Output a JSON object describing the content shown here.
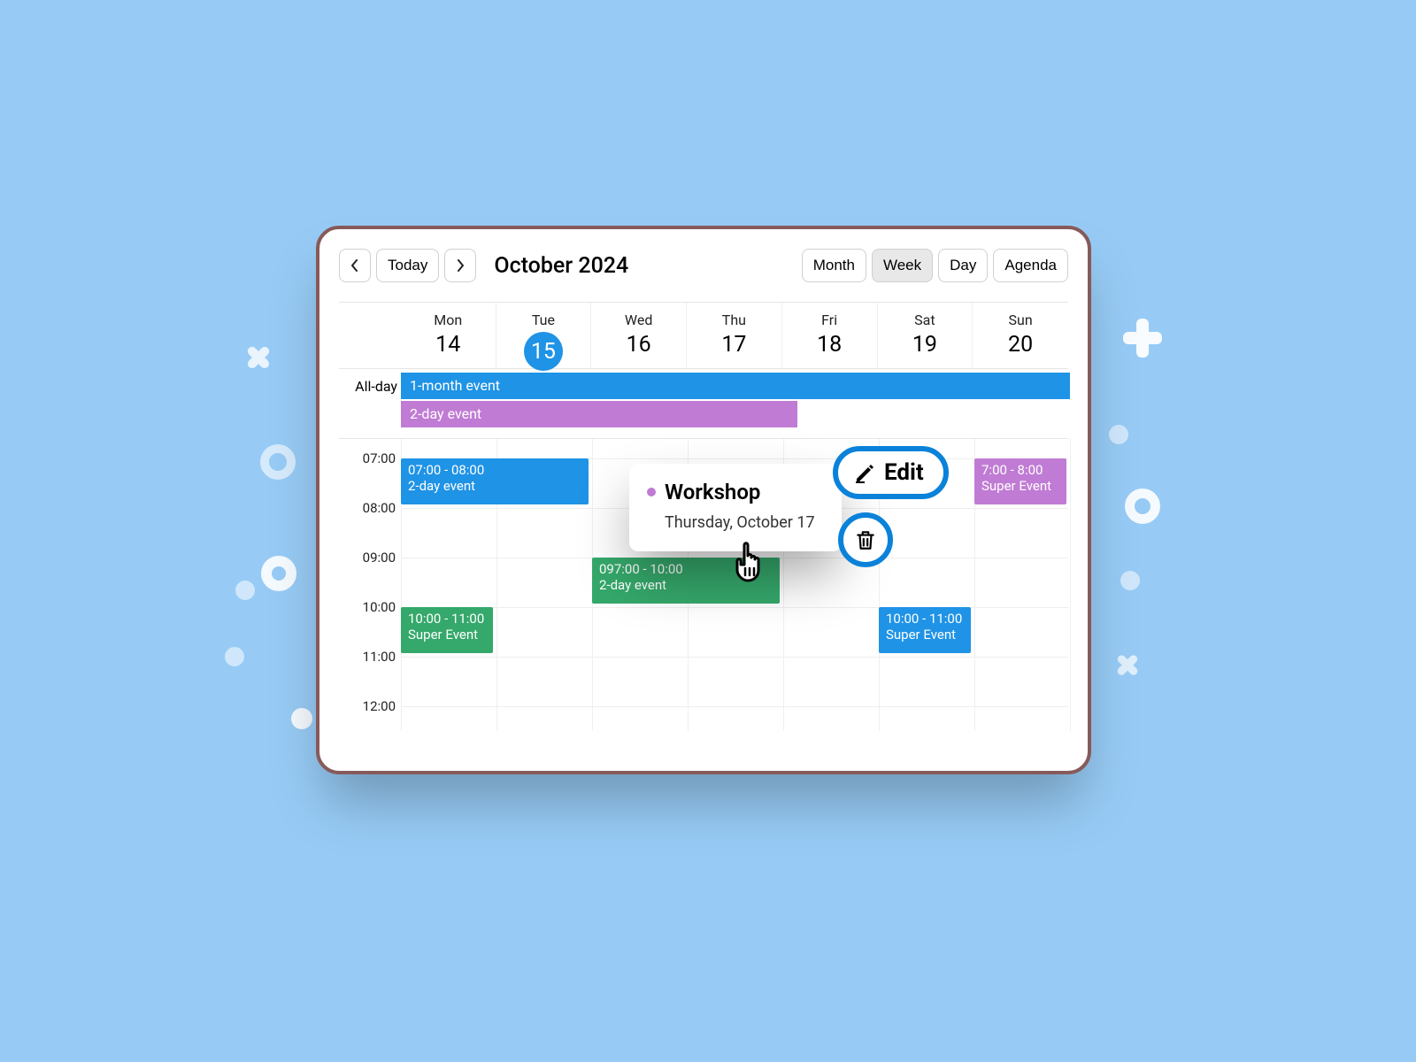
{
  "toolbar": {
    "today_label": "Today",
    "title": "October 2024",
    "views": {
      "month": "Month",
      "week": "Week",
      "day": "Day",
      "agenda": "Agenda"
    },
    "active_view": "Week"
  },
  "calendar": {
    "allday_label": "All-day",
    "days": [
      {
        "weekday": "Mon",
        "date": "14",
        "current": false
      },
      {
        "weekday": "Tue",
        "date": "15",
        "current": true
      },
      {
        "weekday": "Wed",
        "date": "16",
        "current": false
      },
      {
        "weekday": "Thu",
        "date": "17",
        "current": false
      },
      {
        "weekday": "Fri",
        "date": "18",
        "current": false
      },
      {
        "weekday": "Sat",
        "date": "19",
        "current": false
      },
      {
        "weekday": "Sun",
        "date": "20",
        "current": false
      }
    ],
    "time_labels": [
      "07:00",
      "08:00",
      "09:00",
      "10:00",
      "11:00",
      "12:00"
    ],
    "allday_events": [
      {
        "title": "1-month event",
        "color": "blue",
        "start_col": 0,
        "span": 7,
        "row": 0
      },
      {
        "title": "2-day event",
        "color": "purple",
        "start_col": 0,
        "span": 4,
        "row": 1
      }
    ],
    "events": [
      {
        "time": "07:00 - 08:00",
        "title": "2-day event",
        "color": "blue",
        "col": 0,
        "start": "07:00",
        "end": "08:00",
        "span_cols": 2
      },
      {
        "time": "097:00 - 10:00",
        "title": "2-day event",
        "color": "green",
        "col": 2,
        "start": "09:00",
        "end": "10:00",
        "span_cols": 2
      },
      {
        "time": "10:00 - 11:00",
        "title": "Super Event",
        "color": "green",
        "col": 0,
        "start": "10:00",
        "end": "11:00",
        "span_cols": 1
      },
      {
        "time": "10:00 - 11:00",
        "title": "Super Event",
        "color": "blue",
        "col": 5,
        "start": "10:00",
        "end": "11:00",
        "span_cols": 1
      },
      {
        "time": "7:00 - 8:00",
        "title": "Super Event",
        "color": "purple",
        "col": 6,
        "start": "07:00",
        "end": "08:00",
        "span_cols": 1
      }
    ]
  },
  "popover": {
    "dot_color": "#c07bd4",
    "title": "Workshop",
    "date": "Thursday, October 17",
    "edit_label": "Edit"
  },
  "colors": {
    "blue": "#1f93e6",
    "purple": "#c07bd4",
    "green": "#35a86b",
    "accent": "#0b82d9",
    "card_border": "#875a5a",
    "background": "#97cbf5"
  }
}
